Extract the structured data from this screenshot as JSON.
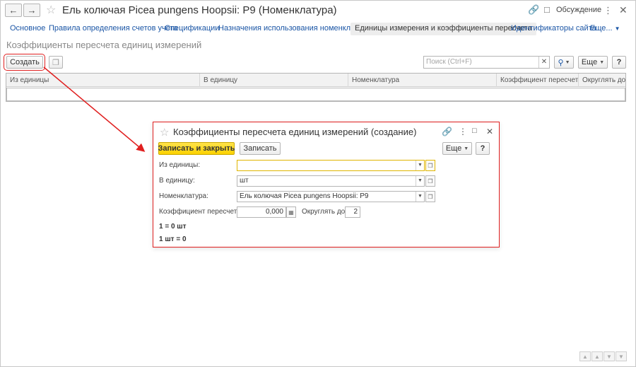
{
  "window": {
    "title": "Ель колючая Picea pungens Hoopsii: P9 (Номенклатура)",
    "discussion_label": "Обсуждение"
  },
  "tabs": [
    {
      "label": "Основное"
    },
    {
      "label": "Правила определения счетов учета"
    },
    {
      "label": "Спецификации"
    },
    {
      "label": "Назначения использования номенклатуры"
    },
    {
      "label": "Единицы измерения и коэффициенты пересчета",
      "active": true
    },
    {
      "label": "Идентификаторы сайта"
    },
    {
      "label": "Еще..."
    }
  ],
  "section": {
    "title": "Коэффициенты пересчета единиц измерений"
  },
  "toolbar": {
    "create_label": "Создать",
    "search_placeholder": "Поиск (Ctrl+F)",
    "more_label": "Еще",
    "help_label": "?"
  },
  "table": {
    "columns": [
      "Из единицы",
      "В единицу",
      "Номенклатура",
      "Коэффициент пересчета",
      "Округлять до"
    ]
  },
  "dialog": {
    "title": "Коэффициенты пересчета единиц измерений (создание)",
    "save_close_label": "Записать и закрыть",
    "save_label": "Записать",
    "more_label": "Еще",
    "help_label": "?",
    "from_unit_label": "Из единицы:",
    "from_unit_value": "",
    "to_unit_label": "В единицу:",
    "to_unit_value": "шт",
    "nomenclature_label": "Номенклатура:",
    "nomenclature_value": "Ель колючая Picea pungens Hoopsii: P9",
    "coefficient_label": "Коэффициент пересчета:",
    "coefficient_value": "0,000",
    "round_label": "Округлять до:",
    "round_value": "2",
    "info_line_1": "1   = 0 шт",
    "info_line_2": "1 шт = 0"
  },
  "colors": {
    "accent_link": "#1a55a5",
    "highlight_red": "#e02020",
    "primary_yellow": "#fbd100"
  }
}
